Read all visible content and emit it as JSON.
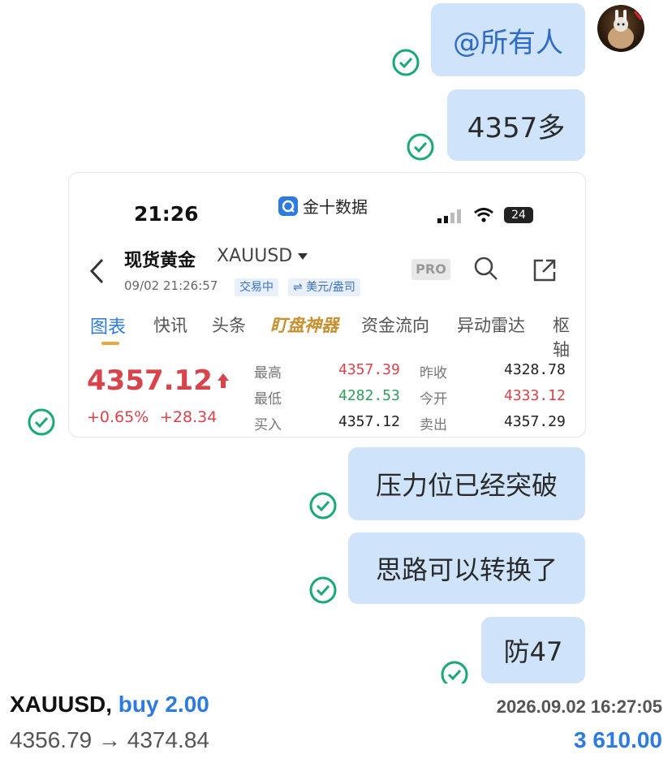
{
  "messages": [
    {
      "text": "@所有人"
    },
    {
      "text": "4357多"
    },
    {
      "text": "压力位已经突破"
    },
    {
      "text": "思路可以转换了"
    },
    {
      "text": "防47"
    }
  ],
  "screenshot_card": {
    "time": "21:26",
    "app_name": "金十数据",
    "battery": "24",
    "instrument_name": "现货黄金",
    "symbol": "XAUUSD",
    "timestamp": "09/02 21:26:57",
    "status_tag": "交易中",
    "currency_tag": "⇌ 美元/盎司",
    "pro_label": "PRO",
    "tabs": [
      "图表",
      "快讯",
      "头条",
      "盯盘神器",
      "资金流向",
      "异动雷达",
      "枢轴"
    ],
    "price": "4357.12",
    "change_pct": "+0.65%",
    "change_abs": "+28.34",
    "stats": {
      "high_label": "最高",
      "high": "4357.39",
      "low_label": "最低",
      "low": "4282.53",
      "bid_label": "买入",
      "bid": "4357.12",
      "prev_close_label": "昨收",
      "prev_close": "4328.78",
      "open_label": "今开",
      "open": "4333.12",
      "ask_label": "卖出",
      "ask": "4357.29"
    }
  },
  "footer": {
    "symbol": "XAUUSD,",
    "side": "buy 2.00",
    "datetime": "2026.09.02 16:27:05",
    "prices": "4356.79 → 4374.84",
    "profit": "3 610.00"
  },
  "colors": {
    "bubble": "#cfe3fb",
    "check": "#19a974",
    "up_red": "#d9434b",
    "down_green": "#2f9e5b",
    "accent_blue": "#2d7be0"
  }
}
